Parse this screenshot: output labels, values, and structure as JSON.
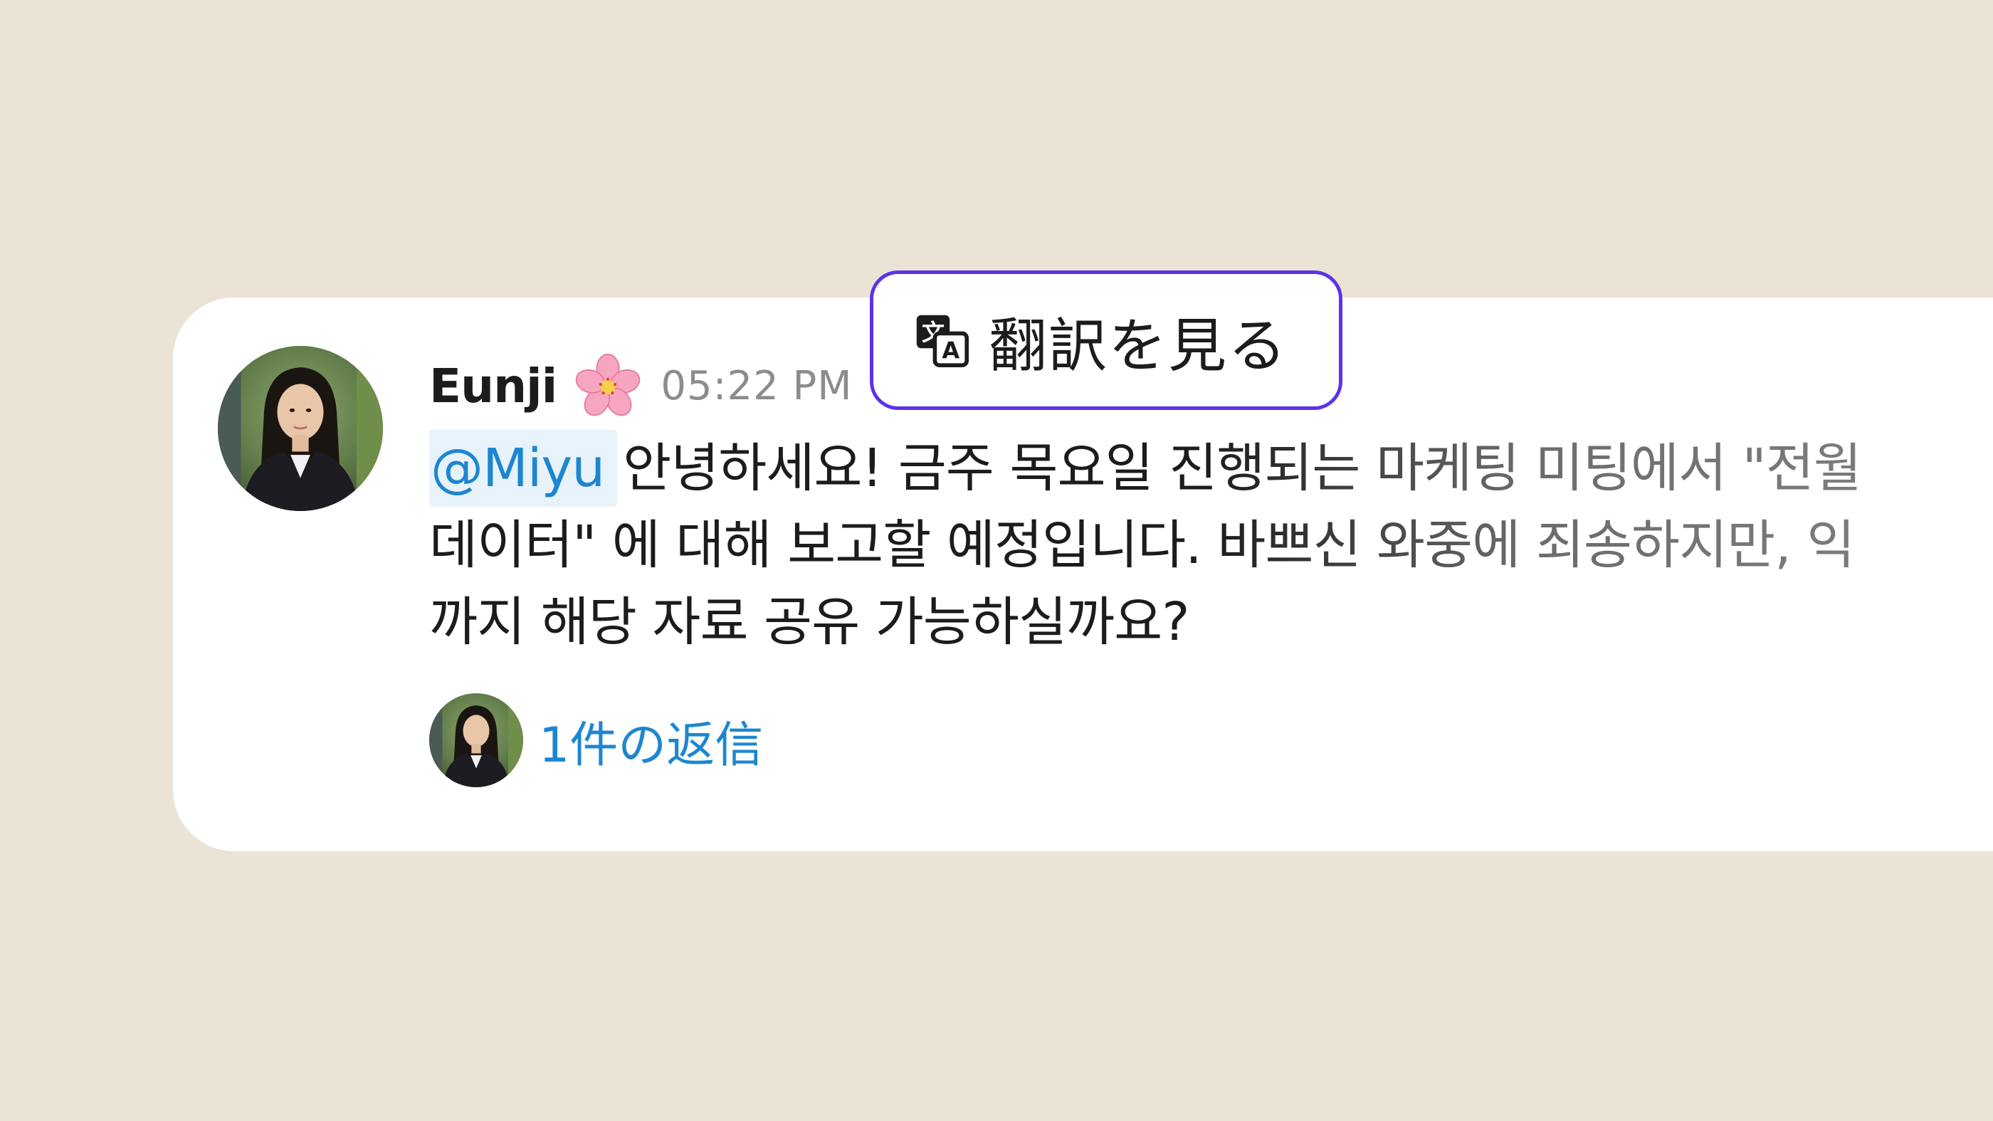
{
  "colors": {
    "background": "#EBE3D6",
    "card": "#FFFFFF",
    "accent_border": "#5B33E8",
    "link": "#1D86D0",
    "mention_bg": "#E8F2FA",
    "text_primary": "#1D1C1D",
    "text_muted": "#8C8C8C"
  },
  "message": {
    "author": {
      "name": "Eunji",
      "status_emoji": "cherry-blossom-icon",
      "avatar": "avatar-photo"
    },
    "timestamp": "05:22 PM",
    "mention": "@Miyu",
    "lines": [
      "안녕하세요! 금주 목요일 진행되는 마케팅 미팅에서 \"전월",
      "데이터\" 에 대해 보고할 예정입니다. 바쁘신 와중에 죄송하지만, 익",
      "까지 해당 자료 공유 가능하실까요?"
    ],
    "replies": {
      "label": "1件の返信"
    }
  },
  "translate_button": {
    "icon": "translate-icon",
    "label": "翻訳を見る"
  }
}
